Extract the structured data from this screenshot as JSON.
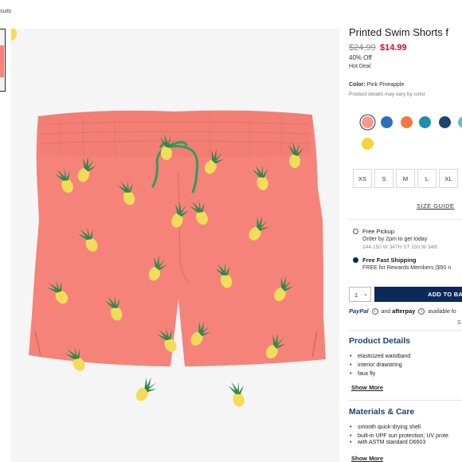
{
  "breadcrumb": {
    "current": "suits"
  },
  "product": {
    "title": "Printed Swim Shorts f",
    "price_was": "$24.99",
    "price_now": "$14.99",
    "discount": "40% Off",
    "deal": "Hot Deal",
    "color_label": "Color:",
    "color_value": "Pink Pineapple",
    "color_note": "Product details may vary by color"
  },
  "swatches": [
    {
      "name": "pink-pineapple",
      "color": "#f59a8f",
      "selected": true
    },
    {
      "name": "blue-print",
      "color": "#2f6fb5"
    },
    {
      "name": "orange",
      "color": "#f07a3e"
    },
    {
      "name": "teal-check",
      "color": "#1a8fb0"
    },
    {
      "name": "navy-print",
      "color": "#1d4470"
    },
    {
      "name": "aqua",
      "color": "#59c7c0"
    },
    {
      "name": "yellow-print",
      "color": "#f2d43a"
    }
  ],
  "sizes": [
    "XS",
    "S",
    "M",
    "L",
    "XL"
  ],
  "size_guide": "SIZE GUIDE",
  "fulfillment": {
    "pickup": {
      "title": "Free Pickup",
      "detail": "Order by 2pm to get today",
      "address": "144-150 W 34TH ST 150 W 34th"
    },
    "shipping": {
      "title": "Free Fast Shipping",
      "detail": "FREE for Rewards Members ($50 n"
    }
  },
  "cart": {
    "quantity": "1",
    "add_label": "ADD TO BA"
  },
  "payments": {
    "paypal": "PayPal",
    "and": "and",
    "afterpay": "afterpay",
    "available": "available fo"
  },
  "s_mark": "S",
  "product_details": {
    "heading": "Product Details",
    "items": [
      "elasticized waistband",
      "interior drawstring",
      "faux fly"
    ],
    "more": "Show More"
  },
  "materials": {
    "heading": "Materials & Care",
    "items": [
      "smooth quick-drying shell",
      "built-in UPF sun protection; UV prote",
      "with ASTM standard D6603"
    ],
    "more": "Show More"
  },
  "colors": {
    "accent": "#0b2a5a",
    "sale": "#c8102e",
    "heading": "#1b3f7a",
    "shorts": "#f5837a"
  }
}
